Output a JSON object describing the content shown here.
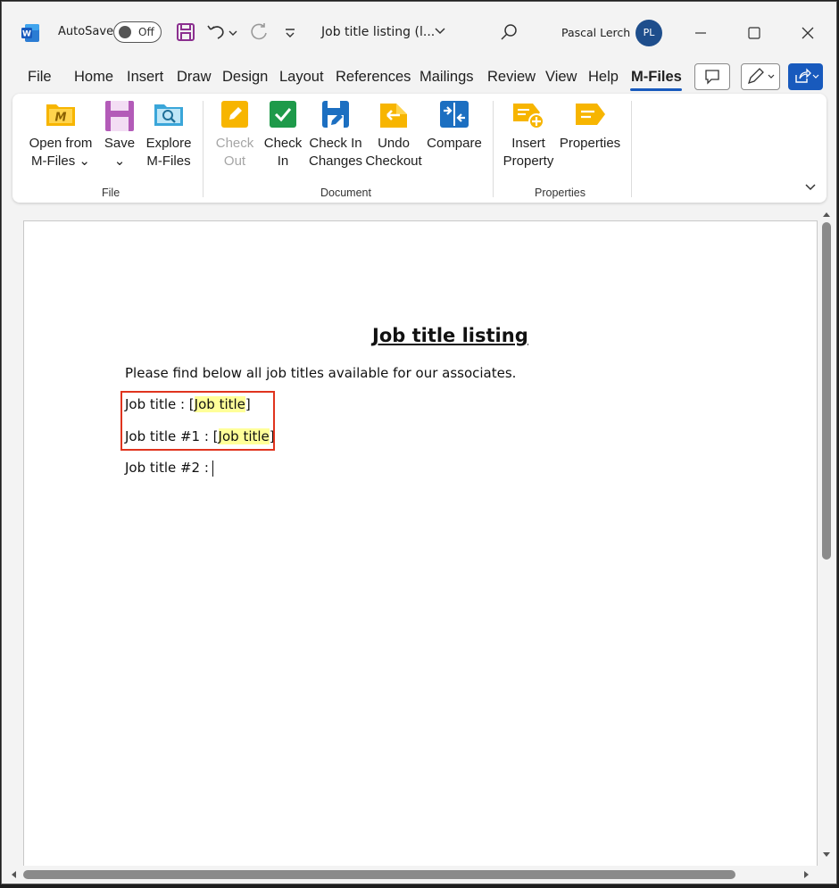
{
  "titlebar": {
    "autosave_label": "AutoSave",
    "autosave_state": "Off",
    "document_title": "Job title listing (l...",
    "user_name": "Pascal Lerch",
    "user_initials": "PL"
  },
  "menu": {
    "tabs": [
      "File",
      "Home",
      "Insert",
      "Draw",
      "Design",
      "Layout",
      "References",
      "Mailings",
      "Review",
      "View",
      "Help",
      "M-Files"
    ],
    "active_tab": "M-Files"
  },
  "ribbon": {
    "groups": [
      {
        "label": "File",
        "buttons": [
          {
            "line1": "Open from",
            "line2": "M-Files ⌄",
            "icon": "m-files-folder-icon",
            "enabled": true
          },
          {
            "line1": "Save",
            "line2": "⌄",
            "icon": "save-icon",
            "enabled": true
          },
          {
            "line1": "Explore",
            "line2": "M-Files",
            "icon": "explore-icon",
            "enabled": true
          }
        ]
      },
      {
        "label": "Document",
        "buttons": [
          {
            "line1": "Check",
            "line2": "Out",
            "icon": "check-out-icon",
            "enabled": false
          },
          {
            "line1": "Check",
            "line2": "In",
            "icon": "check-in-icon",
            "enabled": true
          },
          {
            "line1": "Check In",
            "line2": "Changes",
            "icon": "check-in-changes-icon",
            "enabled": true
          },
          {
            "line1": "Undo",
            "line2": "Checkout",
            "icon": "undo-checkout-icon",
            "enabled": true
          },
          {
            "line1": "Compare",
            "line2": "",
            "icon": "compare-icon",
            "enabled": true
          }
        ]
      },
      {
        "label": "Properties",
        "buttons": [
          {
            "line1": "Insert",
            "line2": "Property",
            "icon": "insert-property-icon",
            "enabled": true
          },
          {
            "line1": "Properties",
            "line2": "",
            "icon": "properties-icon",
            "enabled": true
          }
        ]
      }
    ]
  },
  "document": {
    "heading": "Job title listing",
    "intro": "Please find below all job titles available for our associates.",
    "line1_prefix": "Job title : [",
    "line1_field": "Job title",
    "line1_suffix": "]",
    "line2_prefix": "Job title #1 : [",
    "line2_field": "Job title",
    "line2_suffix": "]",
    "line3_prefix": "Job title #2 :"
  },
  "colors": {
    "accent": "#185abd",
    "mfiles_yellow": "#f7b500",
    "highlight_box": "#e0341e",
    "field_highlight": "#ffff99"
  }
}
